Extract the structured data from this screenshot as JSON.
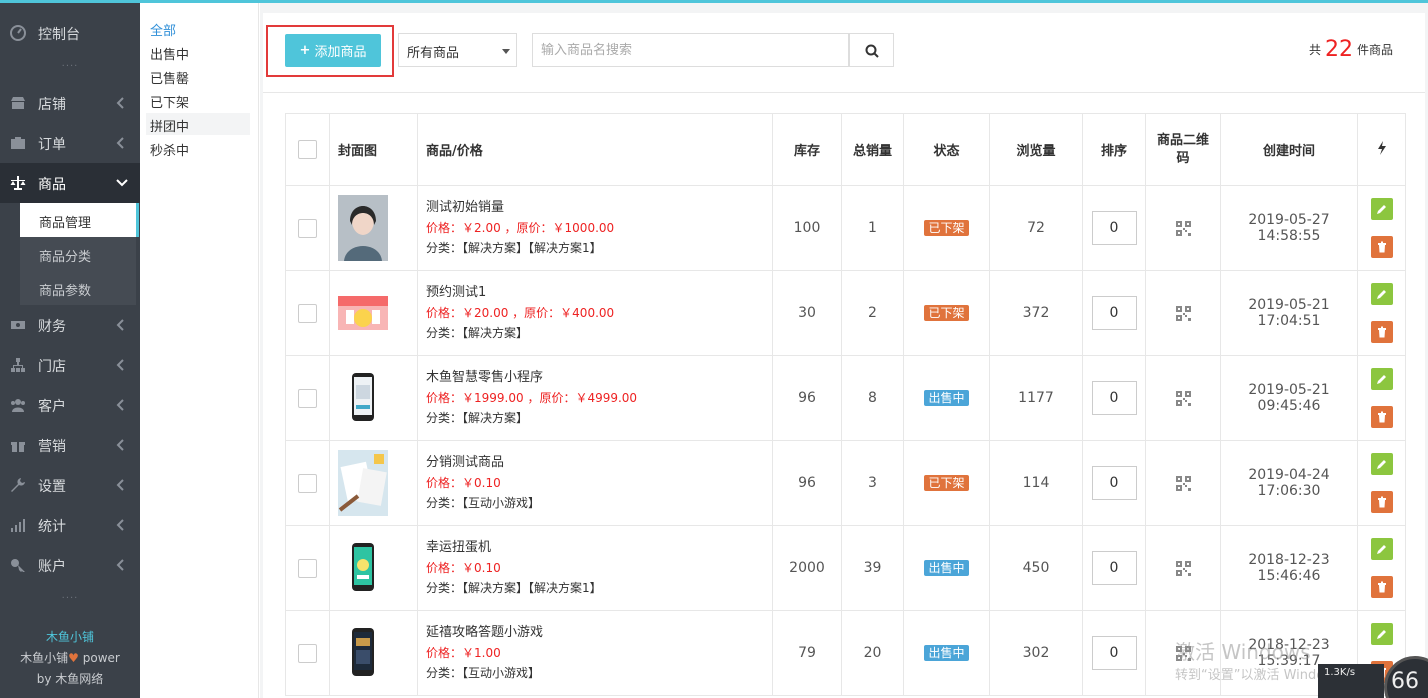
{
  "sidebar": {
    "items": [
      {
        "label": "控制台",
        "icon": "dashboard-icon"
      },
      {
        "label": "店铺",
        "icon": "shop-icon"
      },
      {
        "label": "订单",
        "icon": "order-icon"
      },
      {
        "label": "商品",
        "icon": "scale-icon"
      },
      {
        "label": "财务",
        "icon": "finance-icon"
      },
      {
        "label": "门店",
        "icon": "store-icon"
      },
      {
        "label": "客户",
        "icon": "users-icon"
      },
      {
        "label": "营销",
        "icon": "gift-icon"
      },
      {
        "label": "设置",
        "icon": "wrench-icon"
      },
      {
        "label": "统计",
        "icon": "chart-icon"
      },
      {
        "label": "账户",
        "icon": "key-icon"
      }
    ],
    "subitems": [
      "商品管理",
      "商品分类",
      "商品参数"
    ],
    "brand": {
      "name": "木鱼小铺",
      "power_prefix": "木鱼小铺",
      "power_suffix": "power",
      "by": "by 木鱼网络"
    }
  },
  "subnav": [
    "全部",
    "出售中",
    "已售罄",
    "已下架",
    "拼团中",
    "秒杀中"
  ],
  "toolbar": {
    "add_label": "添加商品",
    "select_value": "所有商品",
    "search_placeholder": "输入商品名搜索",
    "total_prefix": "共",
    "total_count": "22",
    "total_suffix": "件商品"
  },
  "table": {
    "headers": [
      "封面图",
      "商品/价格",
      "库存",
      "总销量",
      "状态",
      "浏览量",
      "排序",
      "商品二维码",
      "创建时间"
    ],
    "rows": [
      {
        "name": "测试初始销量",
        "price": "价格：￥2.00 ，原价：￥1000.00",
        "category": "分类：【解决方案】【解决方案1】",
        "stock": "100",
        "sales": "1",
        "status": "已下架",
        "views": "72",
        "sort": "0",
        "created": "2019-05-27 14:58:55"
      },
      {
        "name": "预约测试1",
        "price": "价格：￥20.00 ，原价：￥400.00",
        "category": "分类：【解决方案】",
        "stock": "30",
        "sales": "2",
        "status": "已下架",
        "views": "372",
        "sort": "0",
        "created": "2019-05-21 17:04:51"
      },
      {
        "name": "木鱼智慧零售小程序",
        "price": "价格：￥1999.00 ，原价：￥4999.00",
        "category": "分类：【解决方案】",
        "stock": "96",
        "sales": "8",
        "status": "出售中",
        "views": "1177",
        "sort": "0",
        "created": "2019-05-21 09:45:46"
      },
      {
        "name": "分销测试商品",
        "price": "价格：￥0.10",
        "category": "分类：【互动小游戏】",
        "stock": "96",
        "sales": "3",
        "status": "已下架",
        "views": "114",
        "sort": "0",
        "created": "2019-04-24 17:06:30"
      },
      {
        "name": "幸运扭蛋机",
        "price": "价格：￥0.10",
        "category": "分类：【解决方案】【解决方案1】",
        "stock": "2000",
        "sales": "39",
        "status": "出售中",
        "views": "450",
        "sort": "0",
        "created": "2018-12-23 15:46:46"
      },
      {
        "name": "延禧攻略答题小游戏",
        "price": "价格：￥1.00",
        "category": "分类：【互动小游戏】",
        "stock": "79",
        "sales": "20",
        "status": "出售中",
        "views": "302",
        "sort": "0",
        "created": "2018-12-23 15:39:17"
      }
    ]
  },
  "overlay": {
    "watermark_line1": "激活 Windows",
    "watermark_line2": "转到“设置”以激活 Windows。",
    "net_speed": "1.3K/s",
    "gauge_value": "66"
  },
  "colors": {
    "accent": "#4fc5da",
    "sidebar_bg": "#3b4149",
    "price_red": "#e22",
    "status_off": "#e0733c",
    "status_on": "#4ba5d8",
    "edit_green": "#8cc63f"
  }
}
